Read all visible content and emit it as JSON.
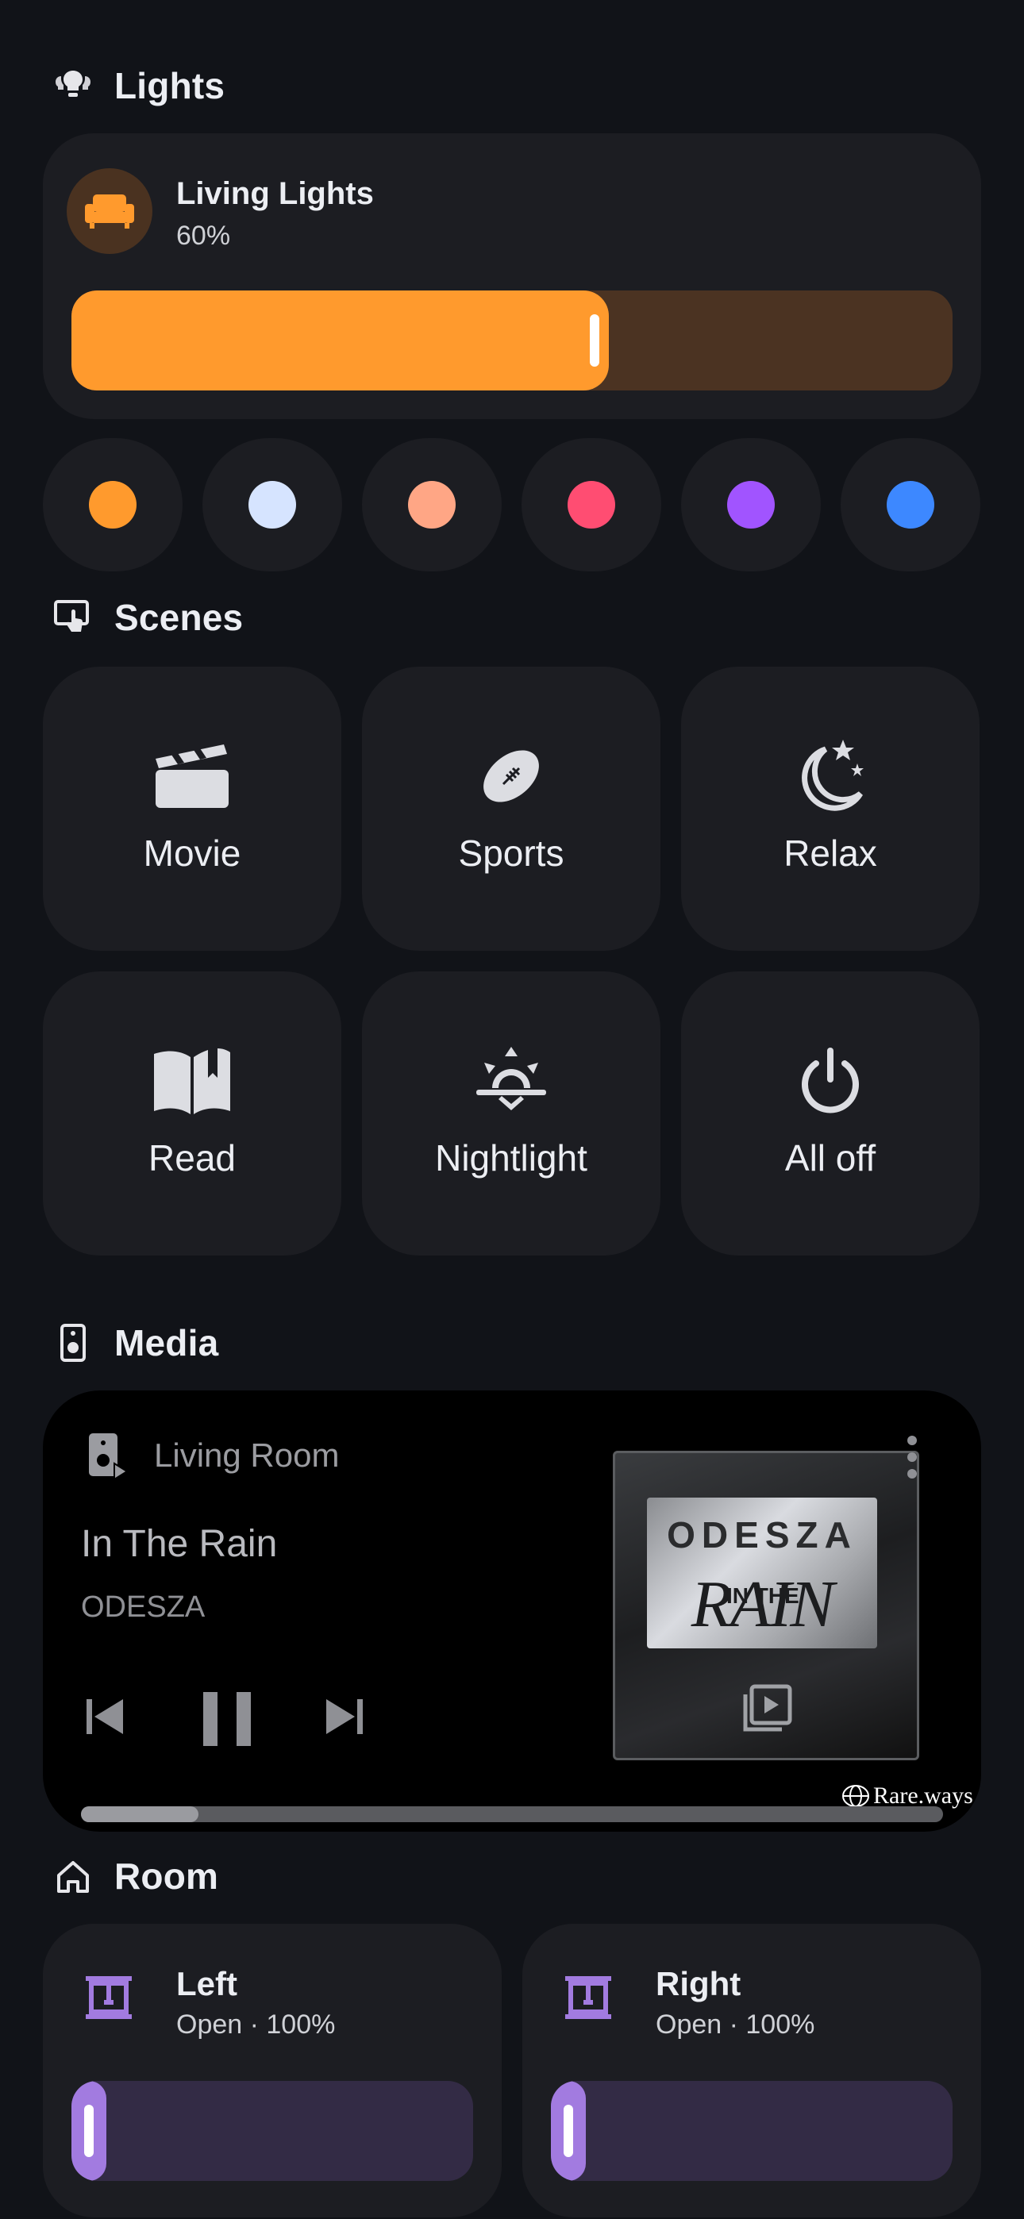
{
  "sections": {
    "lights": "Lights",
    "scenes": "Scenes",
    "media": "Media",
    "room": "Room"
  },
  "light": {
    "name": "Living Lights",
    "value_label": "60%",
    "brightness": 0.61,
    "accent": "#ff9a2d"
  },
  "swatches": [
    "#ff9a2d",
    "#d6e4ff",
    "#ffa685",
    "#ff4d72",
    "#a154ff",
    "#3d88ff"
  ],
  "scenes": [
    {
      "label": "Movie",
      "icon": "clapperboard-icon"
    },
    {
      "label": "Sports",
      "icon": "football-icon"
    },
    {
      "label": "Relax",
      "icon": "moon-stars-icon"
    },
    {
      "label": "Read",
      "icon": "book-open-icon"
    },
    {
      "label": "Nightlight",
      "icon": "sunset-icon"
    },
    {
      "label": "All off",
      "icon": "power-icon"
    }
  ],
  "media": {
    "source": "Living Room",
    "title": "In The Rain",
    "artist": "ODESZA",
    "album_band": "ODESZA",
    "album_word": "RAIN",
    "album_small": "IN THE",
    "watermark": "Rare.ways",
    "progress": 0.14
  },
  "covers": [
    {
      "name": "Left",
      "state": "Open · 100%",
      "level": 1.0
    },
    {
      "name": "Right",
      "state": "Open · 100%",
      "level": 1.0
    }
  ]
}
